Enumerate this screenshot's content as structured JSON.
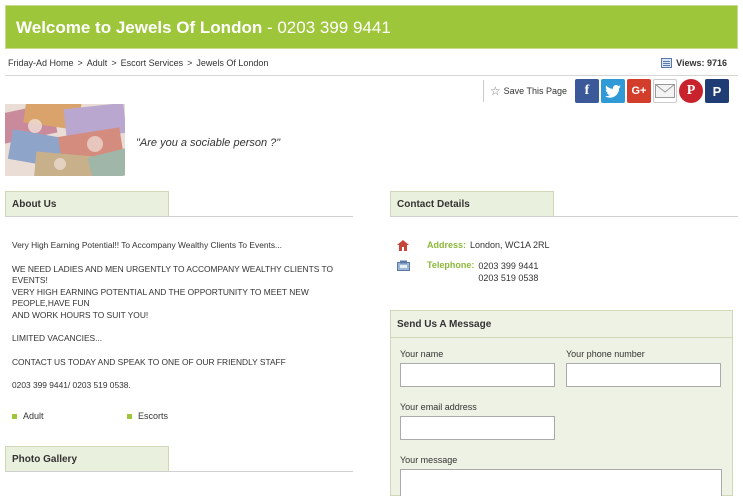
{
  "header": {
    "title": "Welcome to Jewels Of London",
    "phone": " - 0203 399 9441"
  },
  "breadcrumb": {
    "items": [
      "Friday-Ad Home",
      "Adult",
      "Escort Services",
      "Jewels Of London"
    ],
    "separator": ">"
  },
  "views": {
    "label": "Views: 9716"
  },
  "share": {
    "save_label": "Save This Page",
    "icons": [
      "facebook-icon",
      "twitter-icon",
      "google-plus-icon",
      "email-icon",
      "pinterest-icon",
      "p-icon"
    ]
  },
  "tagline": "\"Are you a sociable person ?\"",
  "about": {
    "title": "About Us",
    "paragraphs": [
      "Very High Earning Potential!! To Accompany Wealthy Clients To Events...",
      "WE NEED LADIES AND MEN URGENTLY TO ACCOMPANY WEALTHY CLIENTS TO EVENTS!",
      "VERY HIGH EARNING POTENTIAL AND THE OPPORTUNITY TO MEET NEW PEOPLE,HAVE FUN",
      "AND WORK HOURS TO SUIT YOU!",
      "LIMITED VACANCIES...",
      "CONTACT US TODAY AND SPEAK TO ONE OF OUR FRIENDLY STAFF",
      "0203 399 9441/ 0203 519 0538."
    ],
    "tags": [
      "Adult",
      "Escorts"
    ]
  },
  "gallery": {
    "title": "Photo Gallery"
  },
  "contact": {
    "title": "Contact Details",
    "address_label": "Address:",
    "address_value": "London, WC1A 2RL",
    "telephone_label": "Telephone:",
    "telephone_1": "0203 399 9441",
    "telephone_2": "0203 519 0538"
  },
  "message_form": {
    "title": "Send Us A Message",
    "name_label": "Your name",
    "phone_label": "Your phone number",
    "email_label": "Your email address",
    "message_label": "Your message"
  },
  "colors": {
    "brand_green": "#9dc63a",
    "section_bg": "#eaf0de",
    "label_green": "#8db83a"
  }
}
